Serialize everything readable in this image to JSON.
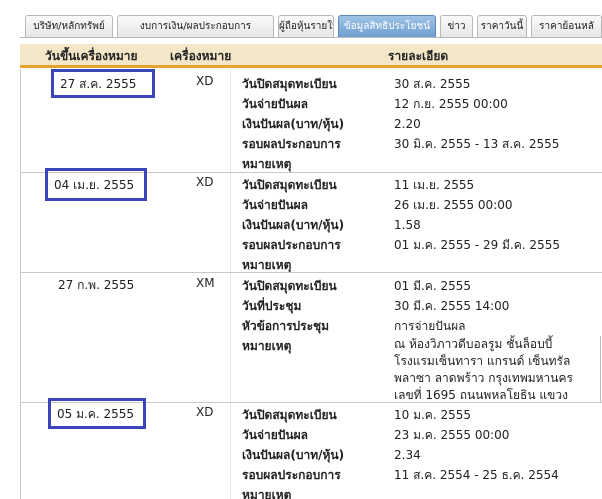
{
  "tabs": [
    {
      "label": "บริษัท/หลักทรัพย์",
      "active": false
    },
    {
      "label": "งบการเงิน/ผลประกอบการ",
      "active": false
    },
    {
      "label": "ผู้ถือหุ้นรายใหญ่",
      "active": false
    },
    {
      "label": "ข้อมูลสิทธิประโยชน์",
      "active": true
    },
    {
      "label": "ข่าว",
      "active": false
    },
    {
      "label": "ราคาวันนี้",
      "active": false
    },
    {
      "label": "ราคาย้อนหลั",
      "active": false
    }
  ],
  "table": {
    "headers": {
      "date": "วันขึ้นเครื่องหมาย",
      "sign": "เครื่องหมาย",
      "detail": "รายละเอียด"
    },
    "rows": [
      {
        "date": "27 ส.ค. 2555",
        "sign": "XD",
        "highlight": true,
        "details": [
          {
            "label": "วันปิดสมุดทะเบียน",
            "value": "30 ส.ค. 2555"
          },
          {
            "label": "วันจ่ายปันผล",
            "value": "12 ก.ย. 2555 00:00"
          },
          {
            "label": "เงินปันผล(บาท/หุ้น)",
            "value": "2.20"
          },
          {
            "label": "รอบผลประกอบการ",
            "value": "30 มิ.ค. 2555 - 13 ส.ค. 2555"
          },
          {
            "label": "หมายเหตุ",
            "value": ""
          }
        ]
      },
      {
        "date": "04 เม.ย. 2555",
        "sign": "XD",
        "highlight": true,
        "details": [
          {
            "label": "วันปิดสมุดทะเบียน",
            "value": "11 เม.ย. 2555"
          },
          {
            "label": "วันจ่ายปันผล",
            "value": "26 เม.ย. 2555 00:00"
          },
          {
            "label": "เงินปันผล(บาท/หุ้น)",
            "value": "1.58"
          },
          {
            "label": "รอบผลประกอบการ",
            "value": "01 ม.ค. 2555 - 29 มี.ค. 2555"
          },
          {
            "label": "หมายเหตุ",
            "value": ""
          }
        ]
      },
      {
        "date": "27 ก.พ. 2555",
        "sign": "XM",
        "highlight": false,
        "details": [
          {
            "label": "วันปิดสมุดทะเบียน",
            "value": "01 มี.ค. 2555"
          },
          {
            "label": "วันที่ประชุม",
            "value": "30 มี.ค. 2555 14:00"
          },
          {
            "label": "หัวข้อการประชุม",
            "value": "การจ่ายปันผล"
          }
        ],
        "note_label": "หมายเหตุ",
        "note_lines": [
          "ณ ห้องวิภาวดีบอลรูม ชั้นล็อบบี้",
          "โรงแรมเซ็นทารา แกรนด์ เซ็นทรัล",
          "พลาซา ลาดพร้าว กรุงเทพมหานคร",
          "เลขที่ 1695 ถนนพหลโยธิน แขวง"
        ]
      },
      {
        "date": "05 ม.ค. 2555",
        "sign": "XD",
        "highlight": true,
        "details": [
          {
            "label": "วันปิดสมุดทะเบียน",
            "value": "10 ม.ค. 2555"
          },
          {
            "label": "วันจ่ายปันผล",
            "value": "23 ม.ค. 2555 00:00"
          },
          {
            "label": "เงินปันผล(บาท/หุ้น)",
            "value": "2.34"
          },
          {
            "label": "รอบผลประกอบการ",
            "value": "11 ส.ค. 2554 - 25 ธ.ค. 2554"
          },
          {
            "label": "หมายเหตุ",
            "value": ""
          }
        ]
      }
    ]
  }
}
